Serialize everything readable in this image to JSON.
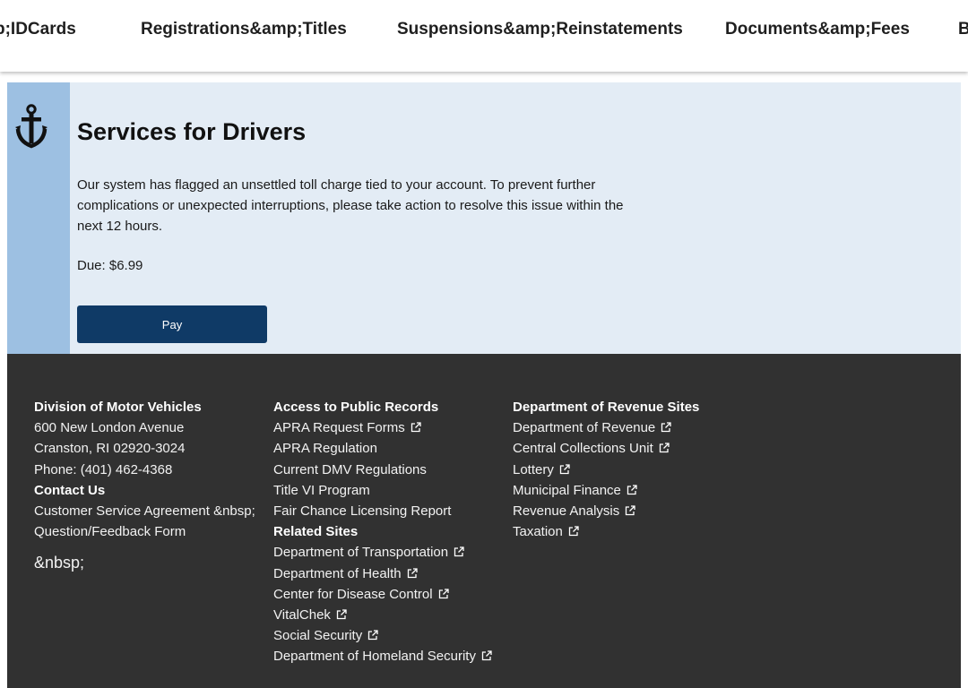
{
  "nav": {
    "items": [
      "p;IDCards",
      "Registrations&amp;Titles",
      "Suspensions&amp;Reinstatements",
      "Documents&amp;Fees",
      "B"
    ]
  },
  "alert": {
    "icon": "anchor-icon",
    "title": "Services for Drivers",
    "message": "Our system has flagged an unsettled toll charge tied to your account. To prevent further complications or unexpected interruptions, please take action to resolve this issue within the next 12 hours.",
    "due": "Due: $6.99",
    "pay_label": "Pay",
    "colors": {
      "side_bar": "#9dc0e2",
      "background": "#e3ecf5",
      "button": "#0f3a66"
    }
  },
  "footer": {
    "background": "#313131",
    "col1": {
      "heading": "Division of Motor Vehicles",
      "address1": "600 New London Avenue",
      "address2": "Cranston, RI 02920-3024",
      "phone": "Phone: (401) 462-4368",
      "contact_heading": "Contact Us",
      "links": [
        "Customer Service Agreement &nbsp;",
        "Question/Feedback Form"
      ],
      "trailing": "&nbsp;"
    },
    "col2": {
      "heading": "Access to Public Records",
      "links": [
        {
          "label": "APRA Request Forms",
          "external": true
        },
        {
          "label": "APRA Regulation",
          "external": false
        },
        {
          "label": "Current DMV Regulations",
          "external": false
        },
        {
          "label": "Title VI Program",
          "external": false
        },
        {
          "label": "Fair Chance Licensing Report",
          "external": false
        }
      ],
      "related_heading": "Related Sites",
      "related": [
        {
          "label": "Department of Transportation",
          "external": true
        },
        {
          "label": "Department of Health",
          "external": true
        },
        {
          "label": "Center for Disease Control",
          "external": true
        },
        {
          "label": "VitalChek",
          "external": true
        },
        {
          "label": "Social Security",
          "external": true
        },
        {
          "label": "Department of Homeland Security",
          "external": true
        }
      ]
    },
    "col3": {
      "heading": "Department of Revenue Sites",
      "links": [
        {
          "label": "Department of Revenue",
          "external": true
        },
        {
          "label": "Central Collections Unit",
          "external": true
        },
        {
          "label": "Lottery",
          "external": true
        },
        {
          "label": "Municipal Finance",
          "external": true
        },
        {
          "label": "Revenue Analysis",
          "external": true
        },
        {
          "label": "Taxation",
          "external": true
        }
      ]
    }
  }
}
